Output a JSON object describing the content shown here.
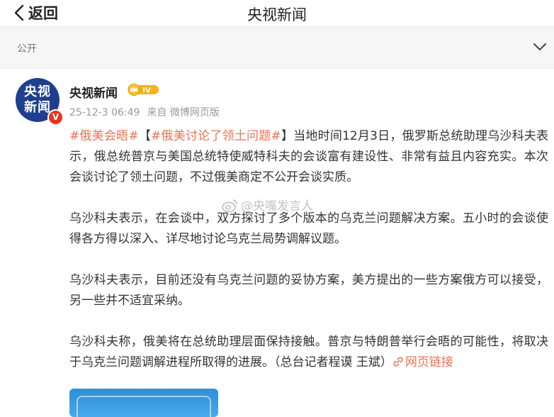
{
  "nav": {
    "back_label": "返回",
    "title": "央视新闻"
  },
  "visibility": {
    "label": "公开"
  },
  "post": {
    "author": "央视新闻",
    "avatar_lines": [
      "央视",
      "新闻"
    ],
    "verified_badge": "V",
    "rank_badge": "IV",
    "date": "25-12-3 06:49",
    "source": "来自 微博网页版",
    "paragraphs": {
      "p1": {
        "tag1": "#俄美会晤#",
        "bracket_open": "【",
        "tag2": "#俄美讨论了领土问题#",
        "bracket_close": "】",
        "text": "当地时间12月3日，俄罗斯总统助理乌沙科夫表示，俄总统普京与美国总统特使威特科夫的会谈富有建设性、非常有益且内容充实。本次会谈讨论了领土问题，不过俄美商定不公开会谈实质。"
      },
      "p2": "乌沙科夫表示，在会谈中，双方探讨了多个版本的乌克兰问题解决方案。五小时的会谈使得各方得以深入、详尽地讨论乌克兰局势调解议题。",
      "p3": "乌沙科夫表示，目前还没有乌克兰问题的妥协方案，美方提出的一些方案俄方可以接受，另一些并不适宜采纳。",
      "p4": {
        "text": "乌沙科夫称，俄美将在总统助理层面保持接触。普京与特朗普举行会晤的可能性，将取决于乌克兰问题调解进程所取得的进展。",
        "credit": "（总台记者程谟 王斌）",
        "link_label": "网页链接"
      }
    },
    "watermark": "@央嘴发言人"
  },
  "colors": {
    "accent": "#eb7350",
    "avatar_bg": "#1f3f8e",
    "verified": "#e8341c",
    "rank_gold": "#f2b418"
  },
  "icons": {
    "back": "chevron-left-icon",
    "expand": "chevron-down-icon",
    "link": "link-icon",
    "watermark": "weibo-logo-icon"
  }
}
